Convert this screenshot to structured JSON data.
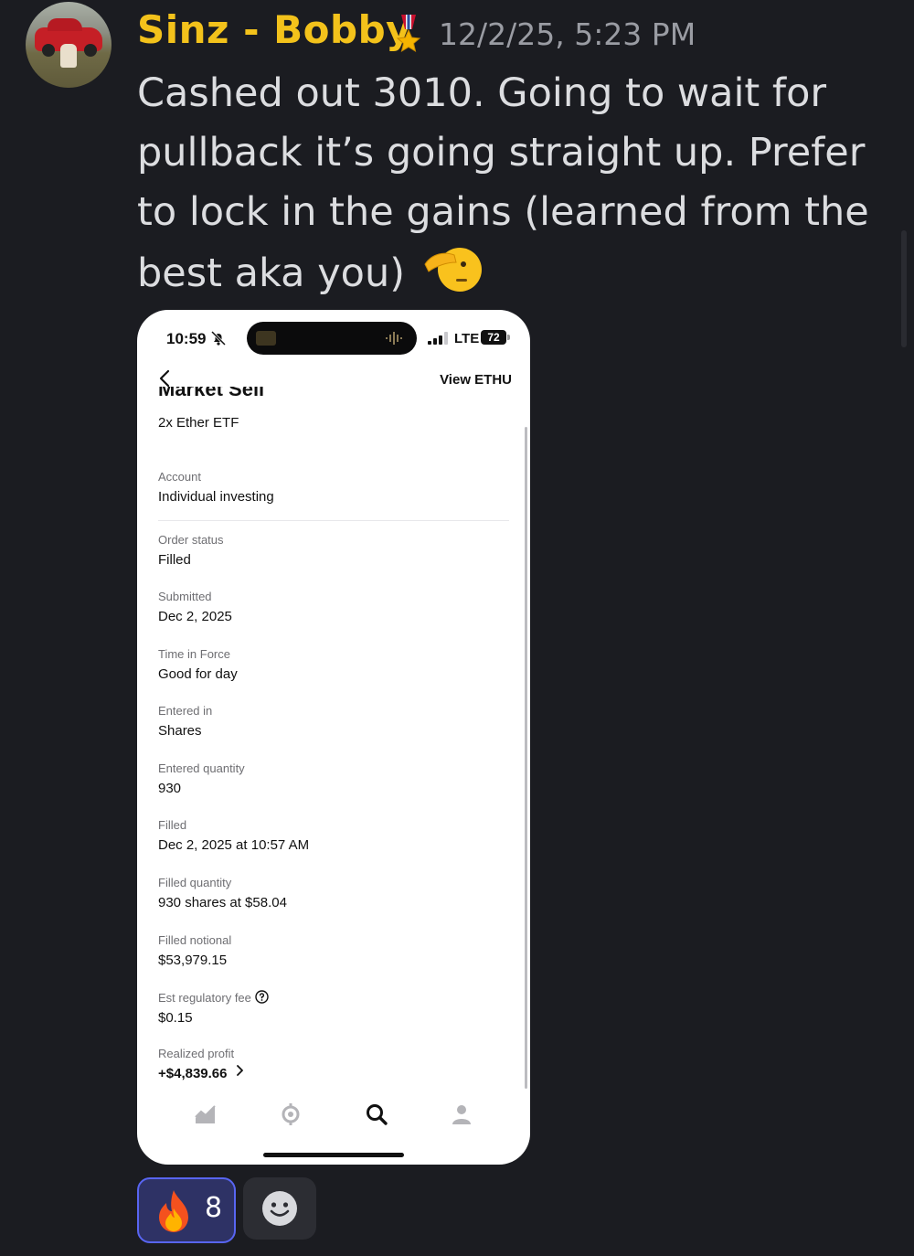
{
  "message": {
    "author": "Sinz - Bobby",
    "author_color": "#f3c21b",
    "badge_icon": "military-medal-icon",
    "timestamp": "12/2/25, 5:23 PM",
    "text": "Cashed out 3010. Going to wait for pullback it’s going straight up. Prefer to lock in the gains (learned from the best aka you)",
    "emoji": "saluting-face-icon"
  },
  "attachment": {
    "status_bar": {
      "time": "10:59",
      "network": "LTE",
      "battery": "72"
    },
    "header": {
      "back_icon": "chevron-left-icon",
      "link": "View ETHU",
      "title_clipped": "Market Sell"
    },
    "subtitle": "2x Ether ETF",
    "fields": [
      {
        "label": "Account",
        "value": "Individual investing"
      },
      {
        "label": "Order status",
        "value": "Filled"
      },
      {
        "label": "Submitted",
        "value": "Dec 2, 2025"
      },
      {
        "label": "Time in Force",
        "value": "Good for day"
      },
      {
        "label": "Entered in",
        "value": "Shares"
      },
      {
        "label": "Entered quantity",
        "value": "930"
      },
      {
        "label": "Filled",
        "value": "Dec 2, 2025 at 10:57 AM"
      },
      {
        "label": "Filled quantity",
        "value": "930 shares at $58.04"
      },
      {
        "label": "Filled notional",
        "value": "$53,979.15"
      },
      {
        "label": "Est regulatory fee",
        "value": "$0.15"
      },
      {
        "label": "Realized profit",
        "value": "+$4,839.66"
      }
    ],
    "tabs": [
      "investing-chart-icon",
      "crypto-icon",
      "search-icon",
      "account-icon"
    ],
    "active_tab": "search-icon"
  },
  "reactions": [
    {
      "emoji": "fire-icon",
      "count": "8",
      "accent": "#5865f2"
    },
    {
      "emoji": "add-reaction-icon"
    }
  ]
}
